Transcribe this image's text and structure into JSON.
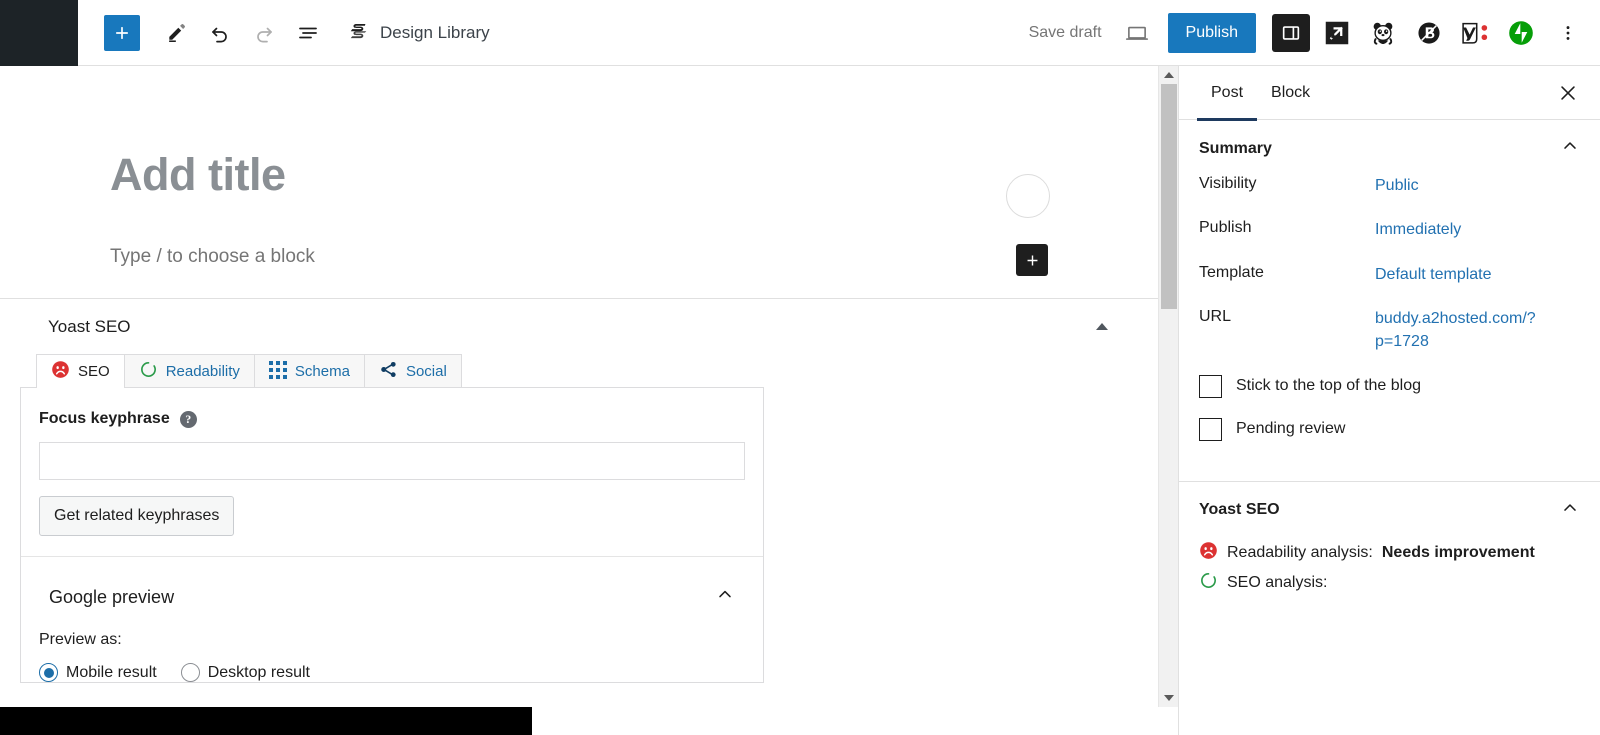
{
  "toolbar": {
    "add_block_label": "+",
    "tools_icon": "pencil-icon",
    "undo_icon": "undo-icon",
    "redo_icon": "redo-icon",
    "list_view_icon": "list-view-icon",
    "design_library_label": "Design Library",
    "design_library_icon": "stackable-logo-icon",
    "save_draft_label": "Save draft",
    "preview_icon": "preview-desktop-icon",
    "publish_label": "Publish",
    "sidebar_toggle_icon": "settings-sidebar-icon",
    "external_icon": "arrow-box-icon",
    "panda_icon": "panda-icon",
    "b_circle_icon": "b-circle-icon",
    "yoast_icon": "yoast-logo-icon",
    "jetpack_icon": "jetpack-icon",
    "options_icon": "kebab-menu-icon"
  },
  "editor": {
    "title_placeholder": "Add title",
    "paragraph_placeholder": "Type / to choose a block",
    "avatar_icon": "avatar-circle-icon",
    "inline_add_label": "+"
  },
  "yoast_metabox": {
    "title": "Yoast SEO",
    "collapse_icon": "triangle-up-icon",
    "tabs": [
      {
        "label": "SEO",
        "icon": "seo-bad-face-icon",
        "active": true
      },
      {
        "label": "Readability",
        "icon": "readability-spinner-icon",
        "active": false
      },
      {
        "label": "Schema",
        "icon": "schema-grid-icon",
        "active": false
      },
      {
        "label": "Social",
        "icon": "social-share-icon",
        "active": false
      }
    ],
    "focus_keyphrase_label": "Focus keyphrase",
    "focus_keyphrase_help": "?",
    "focus_keyphrase_value": "",
    "focus_keyphrase_placeholder": "",
    "get_related_label": "Get related keyphrases",
    "google_preview_title": "Google preview",
    "google_preview_chevron": "chevron-up-icon",
    "preview_as_label": "Preview as:",
    "preview_options": [
      {
        "label": "Mobile result",
        "checked": true
      },
      {
        "label": "Desktop result",
        "checked": false
      }
    ]
  },
  "sidebar": {
    "tabs": [
      {
        "label": "Post",
        "active": true
      },
      {
        "label": "Block",
        "active": false
      }
    ],
    "close_icon": "close-icon",
    "summary": {
      "title": "Summary",
      "chevron": "chevron-up-icon",
      "rows": [
        {
          "label": "Visibility",
          "value": "Public"
        },
        {
          "label": "Publish",
          "value": "Immediately"
        },
        {
          "label": "Template",
          "value": "Default template"
        },
        {
          "label": "URL",
          "value": "buddy.a2hosted.com/?p=1728"
        }
      ],
      "checkboxes": [
        {
          "label": "Stick to the top of the blog",
          "checked": false
        },
        {
          "label": "Pending review",
          "checked": false
        }
      ]
    },
    "yoast": {
      "title": "Yoast SEO",
      "chevron": "chevron-up-icon",
      "readability_label": "Readability analysis:",
      "readability_value": "Needs improvement",
      "readability_icon": "seo-bad-face-icon",
      "seo_label": "SEO analysis:",
      "seo_value": "",
      "seo_icon": "readability-spinner-icon"
    }
  },
  "scrollbar": {
    "up_icon": "scroll-up-arrow-icon",
    "down_icon": "scroll-down-arrow-icon"
  },
  "colors": {
    "publish_blue": "#1878bd",
    "link_blue": "#2271b1",
    "tab_underline": "#1e3a5f",
    "bad_red": "#dc3232",
    "ok_green": "#2b9b4a",
    "admin_dark": "#1d2327"
  }
}
